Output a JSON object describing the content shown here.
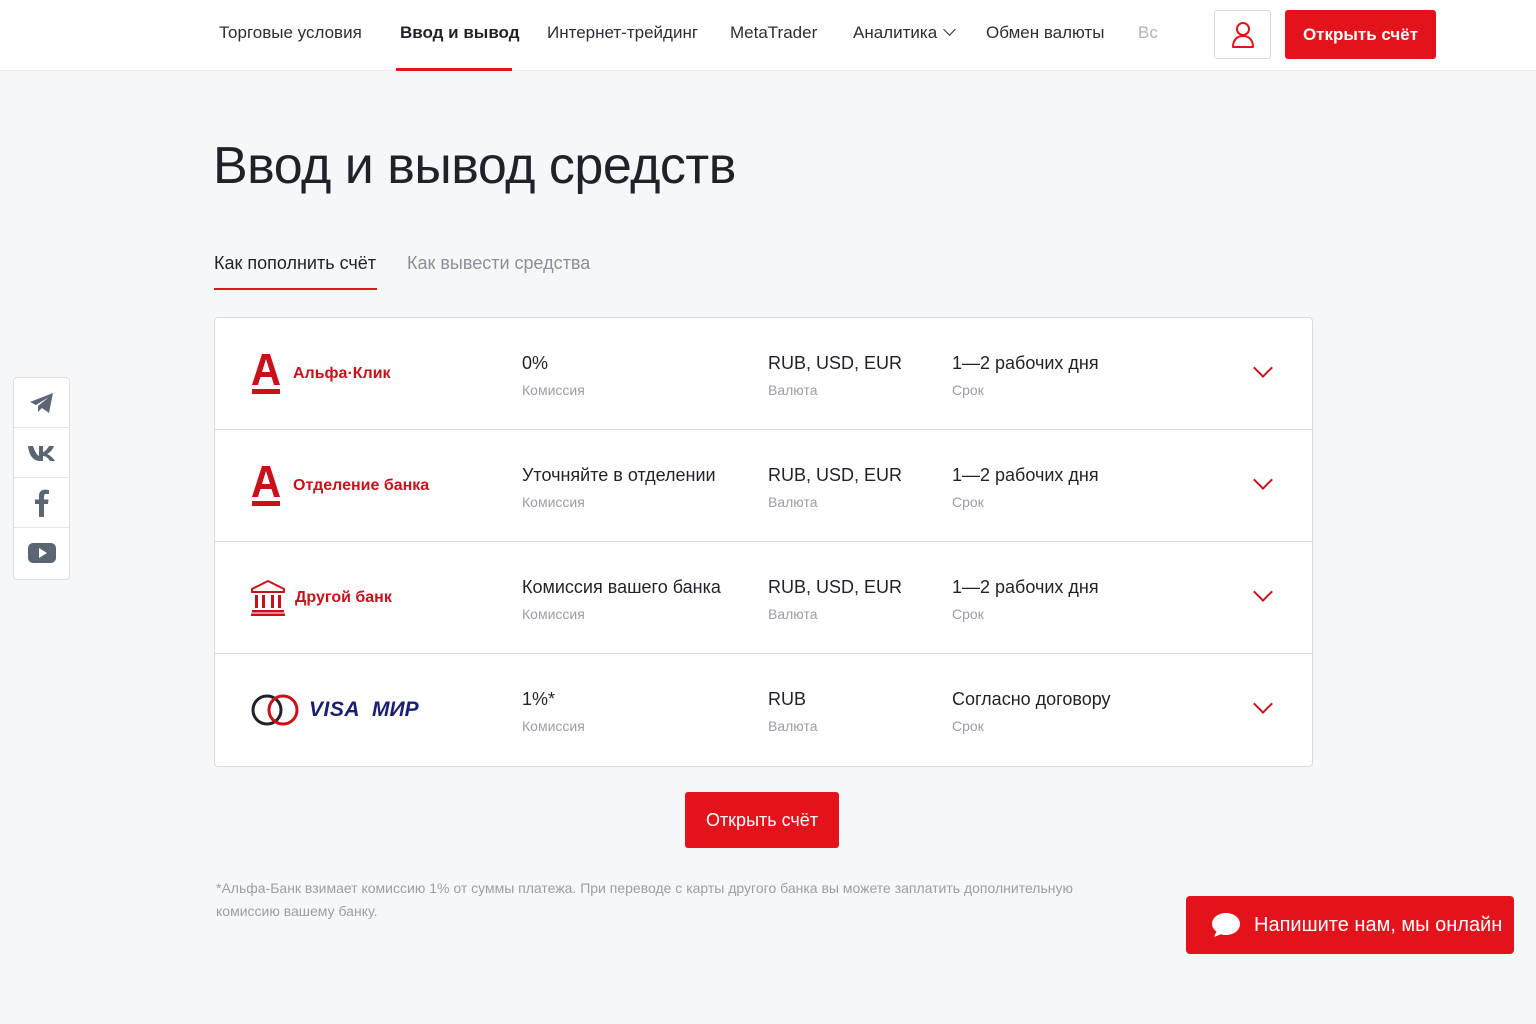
{
  "header": {
    "nav": [
      {
        "label": "Торговые условия",
        "active": false
      },
      {
        "label": "Ввод и вывод",
        "active": true
      },
      {
        "label": "Интернет-трейдинг",
        "active": false
      },
      {
        "label": "MetaTrader",
        "active": false
      },
      {
        "label": "Аналитика",
        "active": false,
        "has_dropdown": true
      },
      {
        "label": "Обмен валюты",
        "active": false
      },
      {
        "label": "Вс",
        "active": false,
        "truncated": true
      }
    ],
    "open_account_label": "Открыть счёт",
    "profile_icon": "user-icon"
  },
  "page": {
    "title": "Ввод и вывод средств"
  },
  "tabs": [
    {
      "label": "Как пополнить счёт",
      "active": true
    },
    {
      "label": "Как вывести средства",
      "active": false
    }
  ],
  "social": [
    {
      "icon": "telegram-icon"
    },
    {
      "icon": "vk-icon"
    },
    {
      "icon": "facebook-icon"
    },
    {
      "icon": "youtube-icon"
    }
  ],
  "methods": [
    {
      "name": "Альфа·Клик",
      "icon": "alfa-logo-icon",
      "commission": "0%",
      "commission_label": "Комиссия",
      "currency": "RUB, USD, EUR",
      "currency_label": "Валюта",
      "term": "1—2 рабочих дня",
      "term_label": "Срок"
    },
    {
      "name": "Отделение банка",
      "icon": "alfa-logo-icon",
      "commission": "Уточняйте в отделении",
      "commission_label": "Комиссия",
      "currency": "RUB, USD, EUR",
      "currency_label": "Валюта",
      "term": "1—2 рабочих дня",
      "term_label": "Срок"
    },
    {
      "name": "Другой банк",
      "icon": "bank-building-icon",
      "commission": "Комиссия вашего банка",
      "commission_label": "Комиссия",
      "currency": "RUB, USD, EUR",
      "currency_label": "Валюта",
      "term": "1—2 рабочих дня",
      "term_label": "Срок"
    },
    {
      "name": "",
      "logos": [
        "mastercard-icon",
        "VISA",
        "МИР"
      ],
      "commission": "1%*",
      "commission_label": "Комиссия",
      "currency": "RUB",
      "currency_label": "Валюта",
      "term": "Согласно договору",
      "term_label": "Срок"
    }
  ],
  "cta": {
    "open_account_label": "Открыть счёт"
  },
  "footnote": "*Альфа-Банк взимает комиссию 1% от суммы платежа. При переводе с карты другого банка вы можете заплатить дополнительную комиссию вашему банку.",
  "chat": {
    "label": "Напишите нам, мы онлайн",
    "icon": "chat-bubble-icon"
  },
  "colors": {
    "accent": "#e4121a",
    "brand_dark_red": "#c8111a",
    "text": "#1f2228",
    "muted": "#9a9ea5",
    "visa_mir_blue": "#1a1f71"
  }
}
